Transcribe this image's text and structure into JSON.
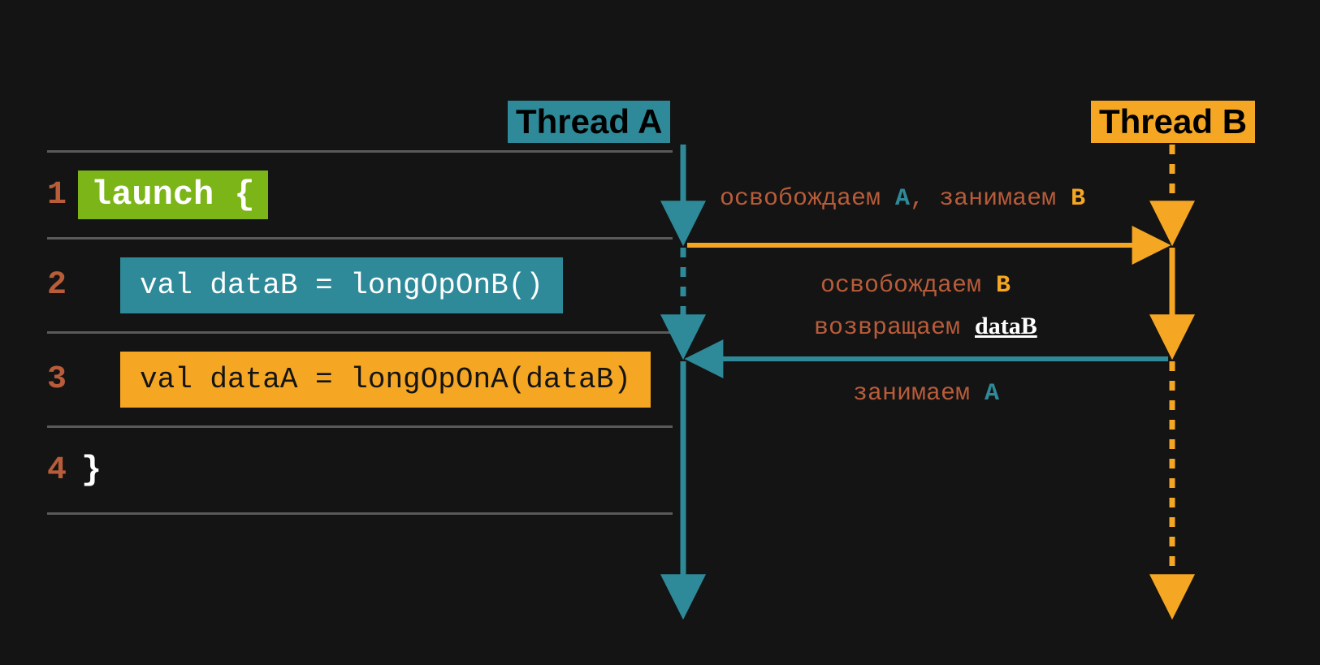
{
  "threads": {
    "a_label": "Thread A",
    "b_label": "Thread B"
  },
  "code": {
    "line1_num": "1",
    "line1_text": "launch {",
    "line2_num": "2",
    "line2_text": "val dataB = longOpOnB()",
    "line3_num": "3",
    "line3_text": "val dataA = longOpOnA(dataB)",
    "line4_num": "4",
    "line4_text": "}"
  },
  "annotations": {
    "release_a_acquire_b_p1": "освобождаем ",
    "release_a_acquire_b_a": "A",
    "release_a_acquire_b_p2": ", занимаем ",
    "release_a_acquire_b_b": "B",
    "release_b_p1": "освобождаем ",
    "release_b_b": "B",
    "return_datab_p1": "возвращаем ",
    "return_datab_val": "dataB",
    "acquire_a_p1": "занимаем ",
    "acquire_a_a": "A"
  },
  "colors": {
    "teal": "#2e8a99",
    "orange": "#f5a623",
    "green": "#7cb518",
    "brown": "#b85c3a",
    "bg": "#141414"
  }
}
